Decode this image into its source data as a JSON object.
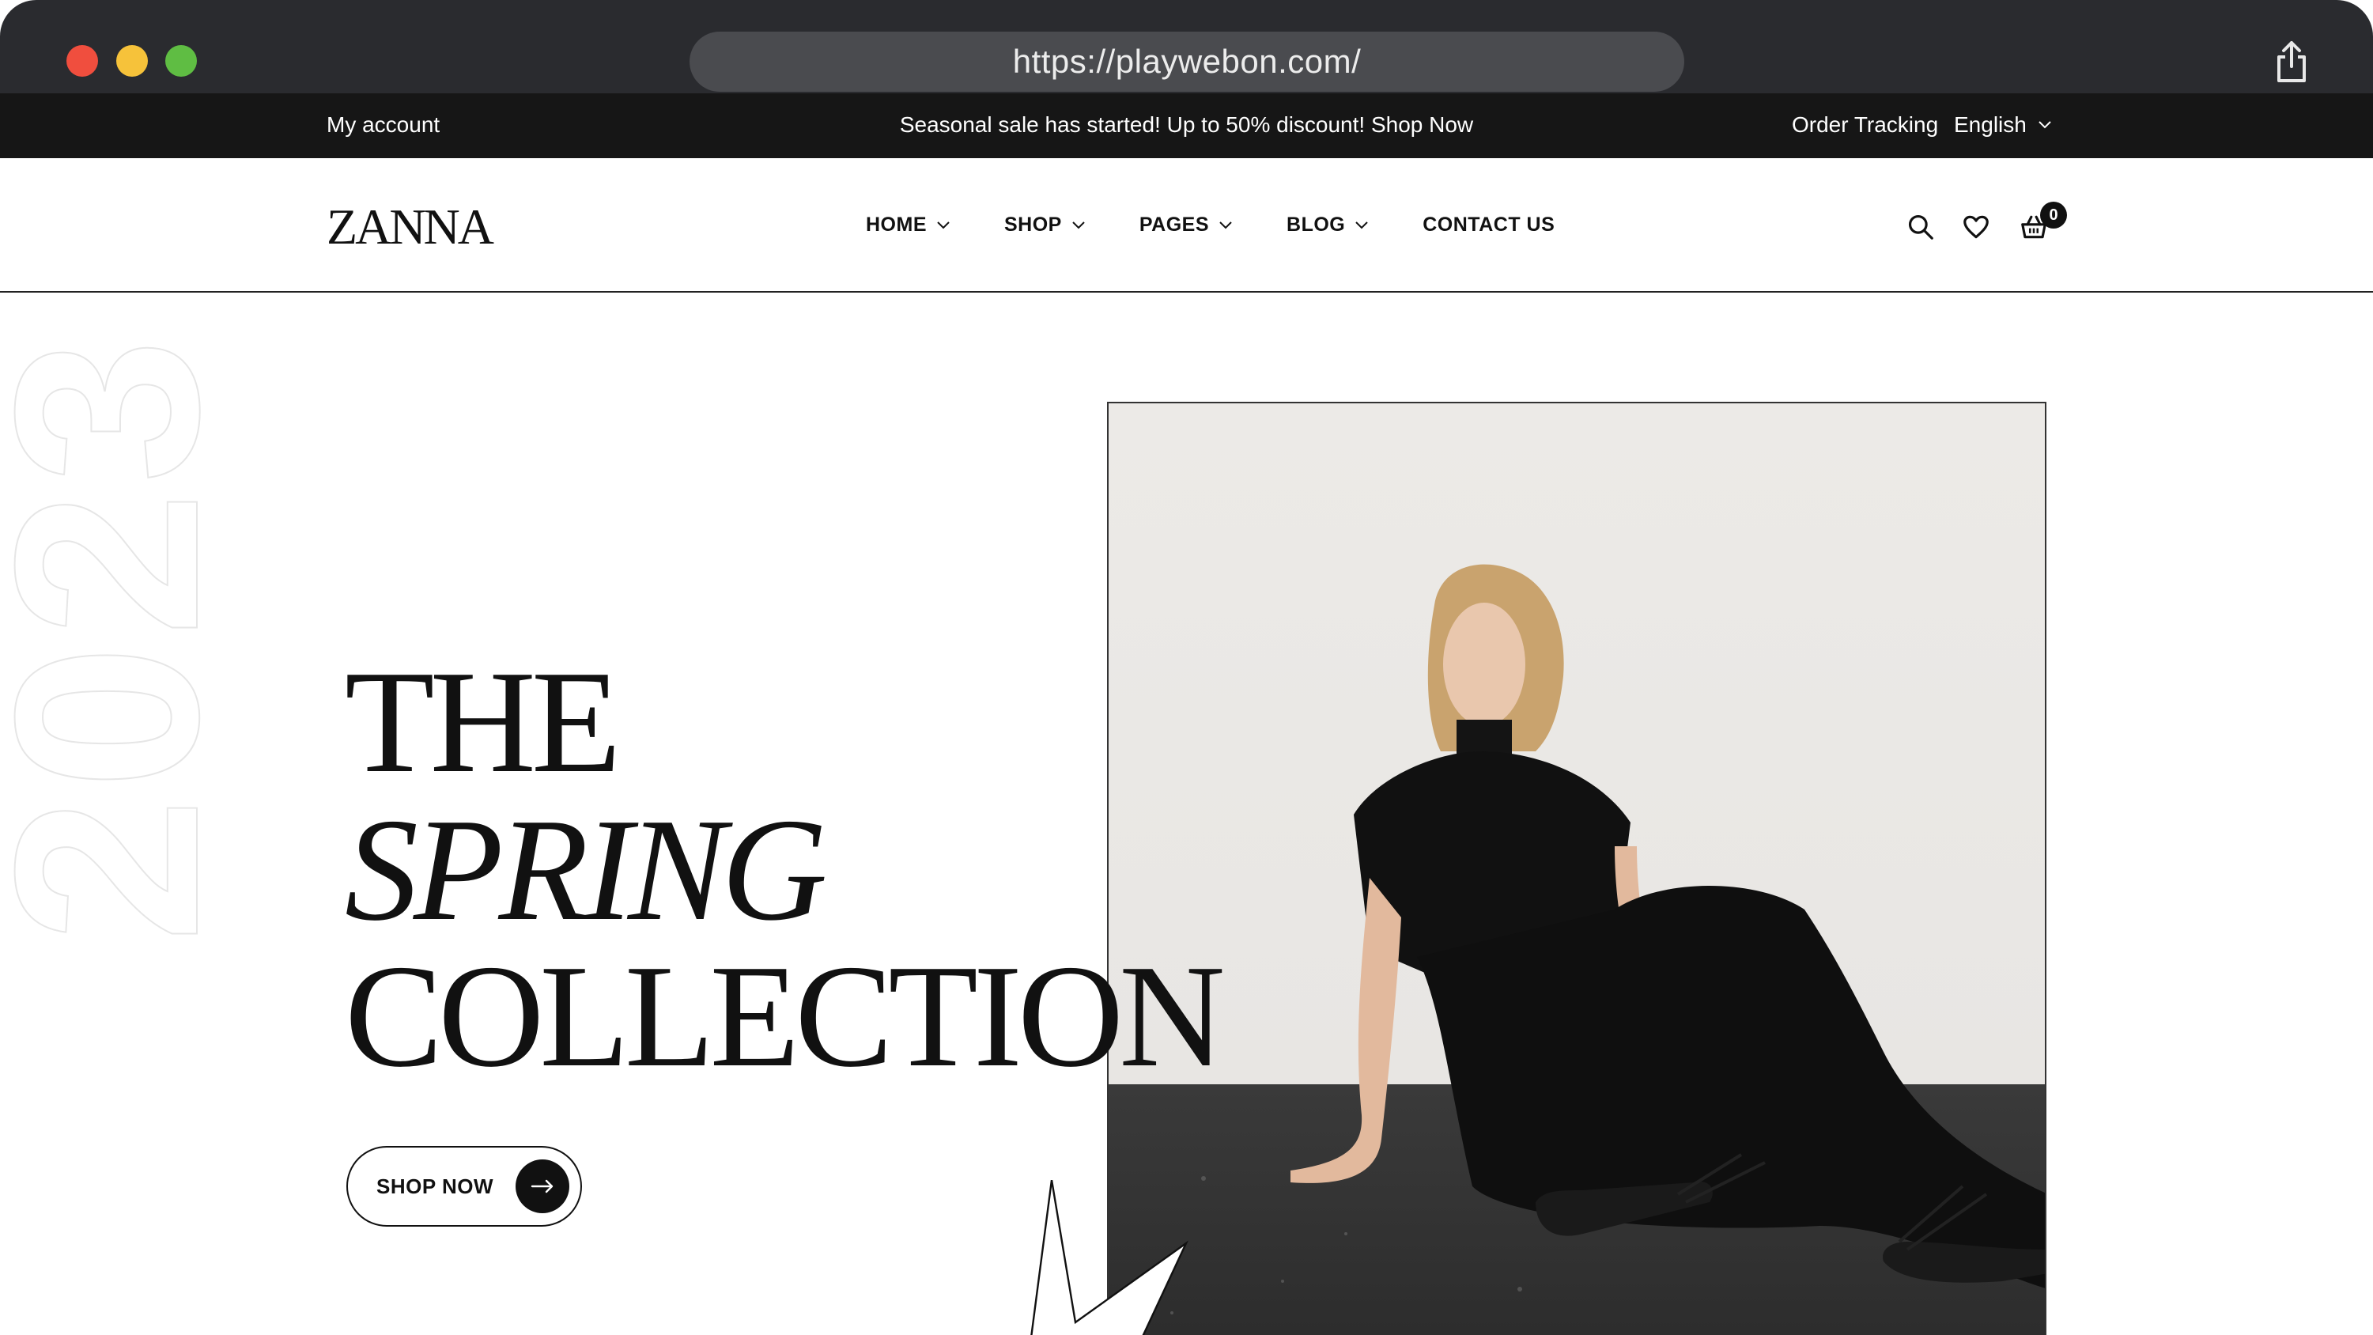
{
  "browser": {
    "url": "https://playwebon.com/"
  },
  "topbar": {
    "my_account": "My account",
    "promo": "Seasonal sale has started! Up to 50% discount! Shop Now",
    "order_tracking": "Order Tracking",
    "language": "English"
  },
  "header": {
    "logo": "ZANNA",
    "nav": [
      {
        "label": "HOME",
        "has_dropdown": true
      },
      {
        "label": "SHOP",
        "has_dropdown": true
      },
      {
        "label": "PAGES",
        "has_dropdown": true
      },
      {
        "label": "BLOG",
        "has_dropdown": true
      },
      {
        "label": "CONTACT US",
        "has_dropdown": false
      }
    ],
    "icons": [
      "search-icon",
      "heart-icon",
      "cart-icon"
    ],
    "cart_count": "0"
  },
  "hero": {
    "year": "2023",
    "title_line1": "THE",
    "title_line2": "SPRING",
    "title_line3": "COLLECTION",
    "cta_label": "SHOP NOW"
  },
  "colors": {
    "chrome": "#2a2b2f",
    "topbar": "#161616",
    "accent": "#111111",
    "window_red": "#f04e3e",
    "window_yellow": "#f6c23a",
    "window_green": "#5fbd43"
  }
}
